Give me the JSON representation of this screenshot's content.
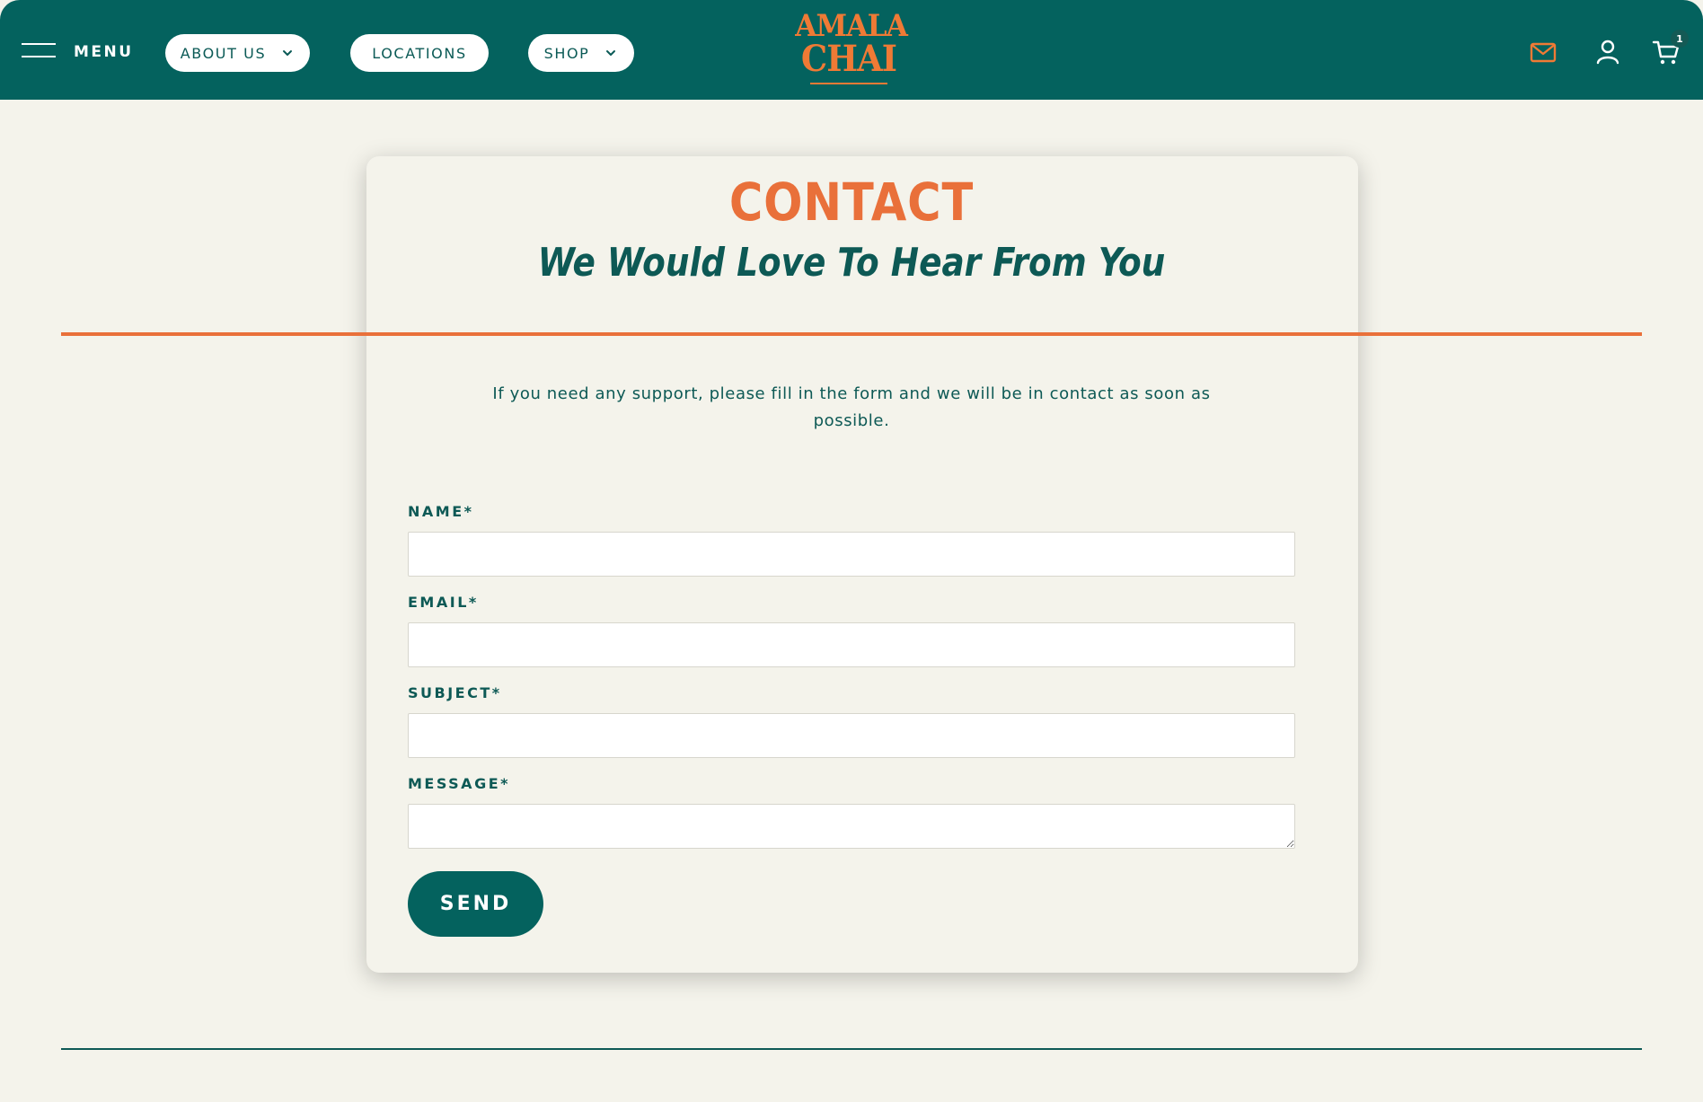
{
  "header": {
    "menu_label": "MENU",
    "nav": {
      "about": "ABOUT US",
      "locations": "LOCATIONS",
      "shop": "SHOP"
    },
    "logo": {
      "line1": "AMALA",
      "line2": "CHAI"
    },
    "cart_count": "1"
  },
  "contact": {
    "title": "CONTACT",
    "subtitle": "We Would Love To Hear From You",
    "intro": "If you need any support, please fill in the form and we will be in contact as soon as possible."
  },
  "form": {
    "name_label": "NAME*",
    "email_label": "EMAIL*",
    "subject_label": "SUBJECT*",
    "message_label": "MESSAGE*",
    "name_value": "",
    "email_value": "",
    "subject_value": "",
    "message_value": "",
    "send_label": "SEND"
  },
  "colors": {
    "header_bg": "#04625e",
    "accent_orange": "#e9703a",
    "page_bg": "#f4f3eb",
    "text_green": "#0d5955"
  },
  "icons": [
    "hamburger-icon",
    "chevron-down-icon",
    "mail-icon",
    "user-icon",
    "cart-icon"
  ]
}
